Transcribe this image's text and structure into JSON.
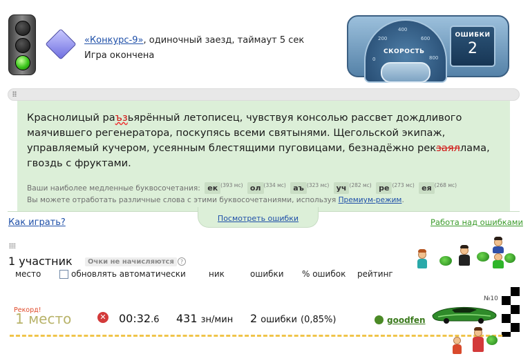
{
  "header": {
    "contest_link": "«Конкурс-9»",
    "contest_rest": ", одиночный заезд, таймаут 5 сек",
    "status": "Игра окончена"
  },
  "dashboard": {
    "speed_label": "СКОРОСТЬ",
    "ticks": [
      "0",
      "200",
      "400",
      "600",
      "800"
    ],
    "errors_label": "ОШИБКИ",
    "errors_value": "2"
  },
  "text": {
    "part1": "Краснолицый ра",
    "err1": "ъз",
    "part2": "ьярённый летописец, чувствуя консолью рассвет дождливого маячившего регенератора, поскупясь всеми святынями. Щегольской экипаж, управляемый кучером, усеянным блестящими пуговицами, безнадёжно рек",
    "err2": "заял",
    "part3": "лама, гвоздь с фруктами."
  },
  "slow_pairs": {
    "label": "Ваши наиболее медленные буквосочетания:",
    "pairs": [
      {
        "text": "ек",
        "ms": "(393 мс)"
      },
      {
        "text": "ол",
        "ms": "(334 мс)"
      },
      {
        "text": "аъ",
        "ms": "(323 мс)"
      },
      {
        "text": "уч",
        "ms": "(282 мс)"
      },
      {
        "text": "ре",
        "ms": "(273 мс)"
      },
      {
        "text": "ея",
        "ms": "(268 мс)"
      }
    ],
    "practice_text": "Вы можете отработать различные слова с этими буквосочетаниями, используя",
    "premium_link": "Премиум-режим",
    "practice_end": "."
  },
  "links": {
    "view_errors": "Посмотреть ошибки",
    "how_to_play": "Как играть?",
    "work_on_errors": "Работа над ошибками"
  },
  "participants": {
    "count": "1 участник",
    "no_points": "Очки не начисляются",
    "help": "?",
    "columns": {
      "place": "место",
      "auto_update": "обновлять автоматически",
      "nick": "ник",
      "errors": "ошибки",
      "errors_pct": "% ошибок",
      "rating": "рейтинг"
    }
  },
  "result": {
    "record": "Рекорд!",
    "place": "1 место",
    "time_main": "00:32",
    "time_frac": ".6",
    "speed_value": "431",
    "speed_unit": "зн/мин",
    "errors_value": "2",
    "errors_unit": "ошибки",
    "errors_pct_open": "(0,85",
    "errors_pct_sign": "%",
    "errors_pct_close": ")",
    "nick": "goodfen",
    "car_number": "№10"
  }
}
